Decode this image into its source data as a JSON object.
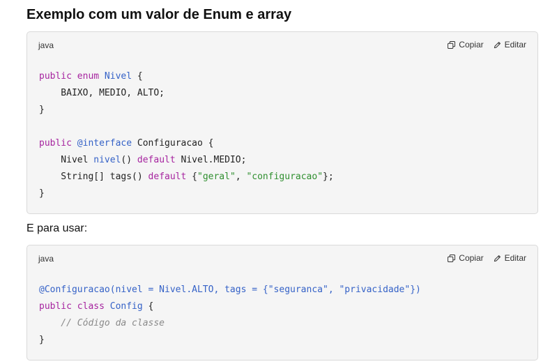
{
  "heading": "Exemplo com um valor de Enum e array",
  "paragraph": "E para usar:",
  "actions": {
    "copy": "Copiar",
    "edit": "Editar"
  },
  "blocks": [
    {
      "lang": "java",
      "lines": {
        "l1": {
          "kw": "public enum",
          "sp1": " ",
          "ty": "Nivel",
          "rest": " {"
        },
        "l2": "    BAIXO, MEDIO, ALTO;",
        "l3": "}",
        "l5": {
          "kw": "public",
          "sp1": " ",
          "ann": "@interface",
          "rest": " Configuracao {"
        },
        "l6": {
          "pre": "    Nivel ",
          "ty": "nivel",
          "mid": "() ",
          "kw": "default",
          "rest": " Nivel.MEDIO;"
        },
        "l7": {
          "pre": "    String[] tags() ",
          "kw": "default",
          "mid": " {",
          "s1": "\"geral\"",
          "comma": ", ",
          "s2": "\"configuracao\"",
          "rest": "};"
        },
        "l8": "}"
      }
    },
    {
      "lang": "java",
      "lines": {
        "l1": "@Configuracao(nivel = Nivel.ALTO, tags = {\"seguranca\", \"privacidade\"})",
        "l2": {
          "kw": "public class",
          "sp1": " ",
          "ty": "Config",
          "rest": " {"
        },
        "l3": "    // Código da classe",
        "l4": "}"
      }
    }
  ]
}
